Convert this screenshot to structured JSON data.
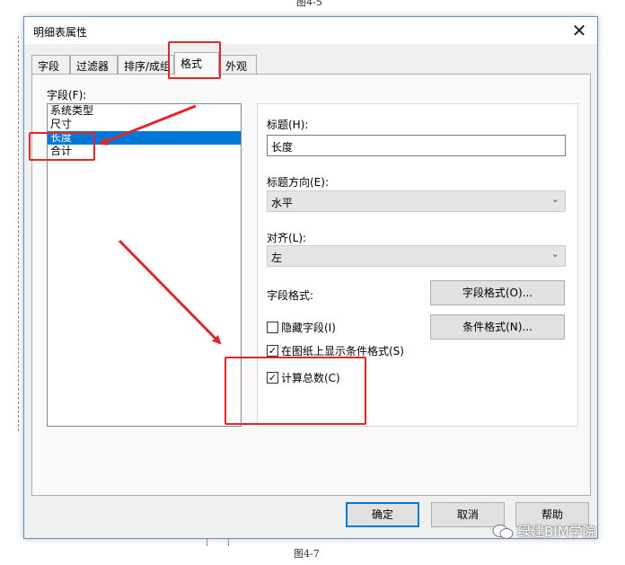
{
  "captions": {
    "top": "图4-5",
    "bottom": "图4-7"
  },
  "window": {
    "title": "明细表属性",
    "close_glyph": "✕"
  },
  "tabs": [
    {
      "label": "字段"
    },
    {
      "label": "过滤器"
    },
    {
      "label": "排序/成组"
    },
    {
      "label": "格式"
    },
    {
      "label": "外观"
    }
  ],
  "fields": {
    "label": "字段(F):",
    "items": [
      "系统类型",
      "尺寸",
      "长度",
      "合计"
    ],
    "selected": "长度"
  },
  "format": {
    "heading_label": "标题(H):",
    "heading_value": "长度",
    "orientation_label": "标题方向(E):",
    "orientation_value": "水平",
    "alignment_label": "对齐(L):",
    "alignment_value": "左",
    "field_format_label": "字段格式:",
    "field_format_button": "字段格式(O)...",
    "conditional_format_button": "条件格式(N)...",
    "hidden_field_label": "隐藏字段(I)",
    "hidden_field_checked": false,
    "show_conditional_label": "在图纸上显示条件格式(S)",
    "show_conditional_checked": true,
    "calculate_totals_label": "计算总数(C)",
    "calculate_totals_checked": true
  },
  "footer": {
    "ok": "确定",
    "cancel": "取消",
    "help": "帮助"
  },
  "watermark": {
    "text": "绿建BIM学院",
    "icon": "wechat-icon"
  },
  "colors": {
    "selection": "#0078d7",
    "annotation": "#e0262a"
  }
}
